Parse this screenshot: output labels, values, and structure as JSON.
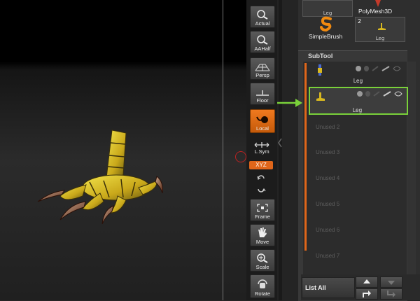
{
  "shelf": {
    "buttons": [
      {
        "label": "Actual"
      },
      {
        "label": "AAHalf"
      },
      {
        "label": "Persp"
      },
      {
        "label": "Floor"
      },
      {
        "label": "Local"
      },
      {
        "label": "L.Sym"
      },
      {
        "label": "Frame"
      },
      {
        "label": "Move"
      },
      {
        "label": "Scale"
      },
      {
        "label": "Rotate"
      }
    ],
    "xyz_label": "XYZ",
    "accent_color": "#e0661a"
  },
  "tools": {
    "top_thumb_label": "Leg",
    "polymesh_label": "PolyMesh3D",
    "simplebrush_label": "SimpleBrush",
    "count_badge": "2",
    "leg_thumb_label": "Leg"
  },
  "subtool": {
    "title": "SubTool",
    "items": [
      {
        "name": "Leg",
        "selected": false
      },
      {
        "name": "Leg",
        "selected": true
      }
    ],
    "unused": [
      "Unused 2",
      "Unused 3",
      "Unused 4",
      "Unused 5",
      "Unused 6",
      "Unused 7"
    ],
    "list_all_label": "List  All",
    "highlight_color": "#7ad13a"
  }
}
